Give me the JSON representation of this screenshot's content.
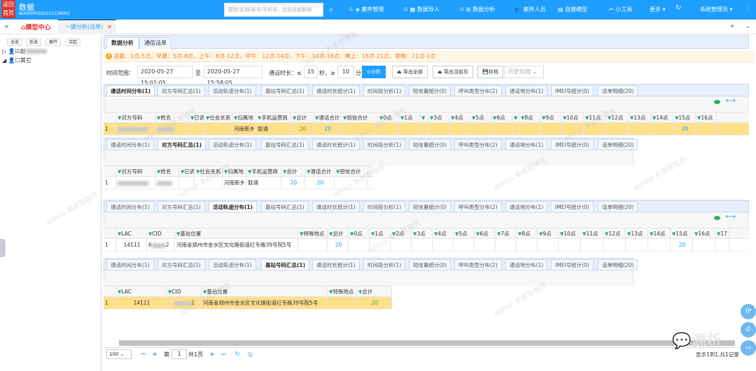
{
  "topbar": {
    "back_home": "返回首页",
    "title": "数据",
    "code": "A000000202211129001",
    "search_placeholder": "模型/名称/账号/手机号，空则全部数据",
    "nav": [
      {
        "num": "①",
        "label": "案件管理"
      },
      {
        "num": "②",
        "label": "数据导入"
      },
      {
        "num": "③",
        "label": "数据分析"
      },
      {
        "num": "",
        "label": "案件人员"
      },
      {
        "num": "",
        "label": "自建模型"
      },
      {
        "num": "",
        "label": "小工具"
      },
      {
        "num": "",
        "label": "更多 ▾"
      }
    ],
    "user": "系统管理员 ▾"
  },
  "tabbar": {
    "home": "模型中心",
    "active_tab": "一键分析(话单)",
    "close": "✕"
  },
  "sidebar": {
    "buttons": [
      "全选",
      "反选",
      "展开",
      "合起"
    ],
    "tree": [
      {
        "label": "赵",
        "checked": true
      },
      {
        "label": "其它",
        "checked": false
      }
    ]
  },
  "main_tabs": [
    "数据分析",
    "通信话单"
  ],
  "notice": "凌晨：1点-5点，早晨：5点-8点，上午：8点-12点，中午：12点-14点，下午：14点-18点，晚上：18点-21点，夜晚：21点-1点",
  "filter": {
    "time_label": "时间范围：",
    "start": "2020-05-27 15:01:05",
    "to": "至",
    "end": "2020-05-27 15:58:05",
    "duration_label": "通话时长：≤",
    "sec_value": "15",
    "sec_unit": "秒，≥",
    "min_value": "10",
    "min_unit": "分",
    "analyze": "分析",
    "export_all": "导出全部",
    "export_page": "导出当前页",
    "archive": "存档",
    "history_placeholder": "历史存档"
  },
  "sub_tabs": [
    "通话时间分布(1)",
    "对方号码汇总(1)",
    "活动轨迹分布(1)",
    "基站号码汇总(1)",
    "通话时长统计(1)",
    "时间段分析(1)",
    "短信量统计(0)",
    "呼叫类型分布(2)",
    "通话地分布(1)",
    "IMEI号统计(0)",
    "话单明细(20)"
  ],
  "panel1": {
    "active": 0,
    "headers": [
      "对方号码",
      "姓名",
      "已调",
      "社会关系",
      "归属地",
      "手机运营商",
      "总计",
      "通话合计",
      "短信合计",
      "0点",
      "1点",
      "",
      "3点",
      "4点",
      "5点",
      "6点",
      "",
      "8点",
      "9点",
      "10点",
      "11点",
      "12点",
      "13点",
      "14点",
      "15点",
      "16点"
    ],
    "row": {
      "index": "1",
      "location": "河南新乡",
      "carrier": "联通",
      "total": "20",
      "call_total": "20",
      "h15": "20"
    }
  },
  "panel2": {
    "active": 1,
    "headers": [
      "对方号码",
      "姓名",
      "已调",
      "社会关系",
      "归属地",
      "手机运营商",
      "总计",
      "通话合计",
      "短信合计"
    ],
    "row": {
      "index": "1",
      "location": "河南新乡",
      "carrier": "联通",
      "total": "20",
      "call_total": "20"
    }
  },
  "panel3": {
    "active": 2,
    "headers": [
      "LAC",
      "CID",
      "基站位置",
      "特殊地点",
      "总计",
      "0点",
      "1点",
      "2点",
      "3点",
      "4点",
      "5点",
      "6点",
      "7点",
      "8点",
      "9点",
      "10点",
      "11点",
      "12点",
      "13点",
      "14点",
      "15点",
      "16点",
      "17"
    ],
    "row": {
      "index": "1",
      "lac": "14111",
      "cid_start": "6",
      "cid_end": "2",
      "address": "河南省郑州市金水区文化路街道红专路39号院5号",
      "total": "20",
      "h15": "20"
    }
  },
  "panel4": {
    "active": 3,
    "headers": [
      "LAC",
      "CID",
      "基站位置",
      "特殊地点",
      "总计"
    ],
    "row": {
      "index": "1",
      "lac": "14111",
      "cid_end": "2",
      "address": "河南省郑州市金水区文化路街道红专路39号院5号",
      "total": "20"
    }
  },
  "pager": {
    "page_size": "100",
    "page_label": "第",
    "page": "1",
    "total_pages": "共1页",
    "summary": "显示1到1,共1记录"
  },
  "float_buttons": [
    "IP",
    "✆",
    "▭"
  ],
  "watermark": "admin 系统管理员",
  "logo_watermark": "源析"
}
